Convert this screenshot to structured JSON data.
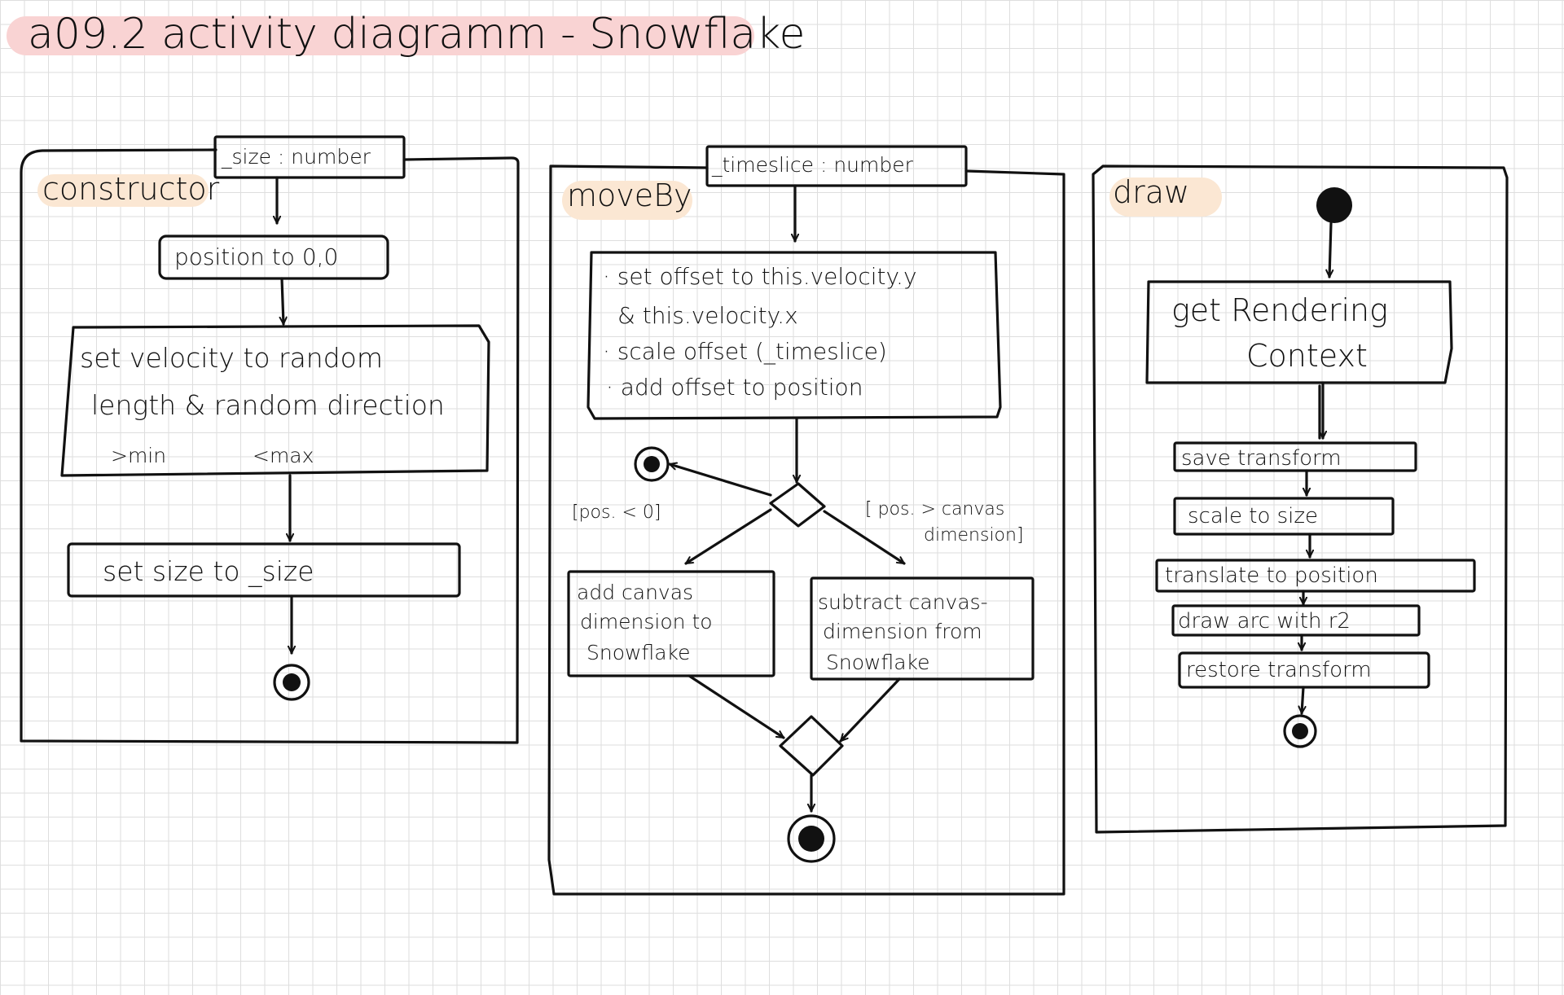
{
  "title": "a09.2 activity diagramm - Snowflake",
  "constructor": {
    "title": "constructor",
    "param": "_size : number",
    "step1": "position to 0,0",
    "step2_line1": "set velocity to random",
    "step2_line2": "length & random direction",
    "step2_min": ">min",
    "step2_max": "<max",
    "step3": "set size to _size"
  },
  "moveBy": {
    "title": "moveBy",
    "param": "_timeslice : number",
    "action_line1": "· set offset to this.velocity.y",
    "action_line2": "& this.velocity.x",
    "action_line3": "· scale offset (_timeslice)",
    "action_line4": "· add offset to position",
    "guard_left": "[pos. < 0]",
    "guard_right_line1": "[ pos. > canvas",
    "guard_right_line2": "dimension]",
    "left_action_line1": "add canvas",
    "left_action_line2": "dimension to",
    "left_action_line3": "Snowflake",
    "right_action_line1": "subtract canvas-",
    "right_action_line2": "dimension from",
    "right_action_line3": "Snowflake"
  },
  "draw": {
    "title": "draw",
    "step1_line1": "get Rendering",
    "step1_line2": "Context",
    "step2": "save transform",
    "step3": "scale to size",
    "step4": "translate to position",
    "step5": "draw arc with r2",
    "step6": "restore transform"
  }
}
